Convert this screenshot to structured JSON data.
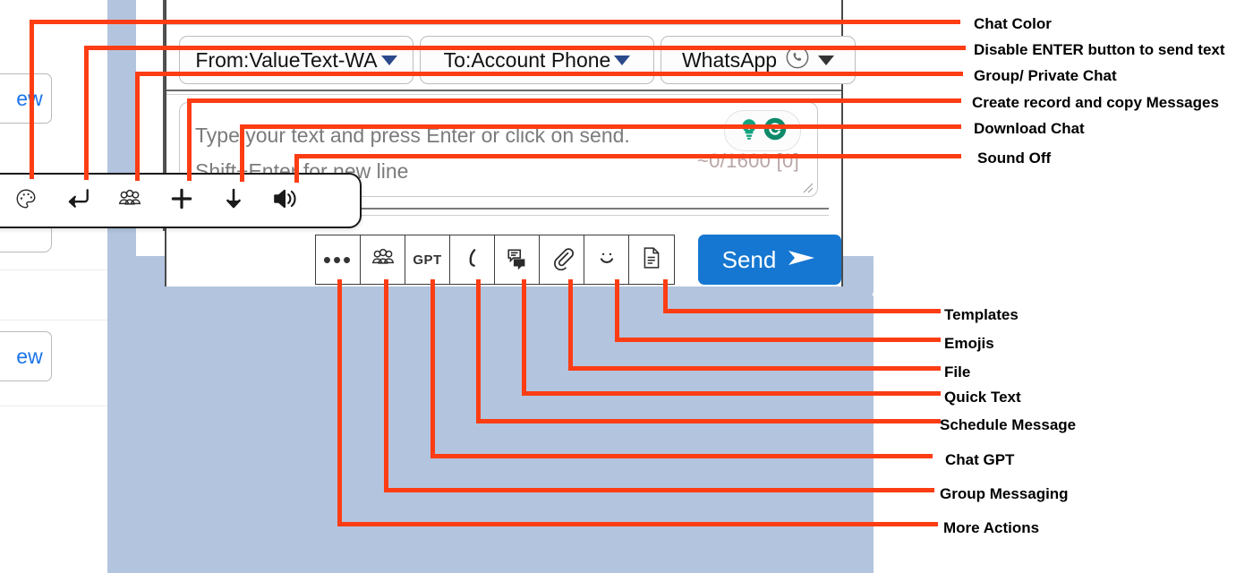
{
  "background": {
    "ghost_buttons": [
      {
        "label": "ew"
      },
      {
        "label": "ew"
      }
    ]
  },
  "compose_window": {
    "selects": [
      {
        "name": "from-select",
        "label": "From:ValueText-WA",
        "caret": "caret-down-icon"
      },
      {
        "name": "to-select",
        "label": "To:Account Phone",
        "caret": "caret-down-icon"
      },
      {
        "name": "channel-select",
        "label": "WhatsApp",
        "icon": "whatsapp-icon",
        "caret": "caret-down-icon"
      }
    ],
    "message_input": {
      "placeholder": "Type your text and press Enter or click on send. Shift+Enter for new line",
      "value": "",
      "counter": "~0/1600 [0]",
      "assistants": [
        "lightbulb-icon",
        "grammarly-icon"
      ]
    },
    "toolbar": [
      {
        "name": "more-actions-button",
        "icon": "ellipsis-icon",
        "glyph": "•••"
      },
      {
        "name": "group-messaging-button",
        "icon": "group-icon"
      },
      {
        "name": "chat-gpt-button",
        "icon": "gpt-icon",
        "glyph": "GPT"
      },
      {
        "name": "schedule-message-button",
        "icon": "clock-icon"
      },
      {
        "name": "quick-text-button",
        "icon": "quick-text-icon"
      },
      {
        "name": "file-button",
        "icon": "paperclip-icon"
      },
      {
        "name": "emojis-button",
        "icon": "smiley-icon"
      },
      {
        "name": "templates-button",
        "icon": "document-icon"
      }
    ],
    "send_button": {
      "label": "Send",
      "icon": "send-arrow-icon"
    }
  },
  "popup_toolbar": [
    {
      "name": "chat-color-button",
      "icon": "palette-icon"
    },
    {
      "name": "disable-enter-button",
      "icon": "enter-key-icon"
    },
    {
      "name": "group-private-chat-button",
      "icon": "group-icon"
    },
    {
      "name": "create-record-button",
      "icon": "plus-icon"
    },
    {
      "name": "download-chat-button",
      "icon": "download-arrow-icon"
    },
    {
      "name": "sound-off-button",
      "icon": "speaker-icon"
    }
  ],
  "annotations": {
    "top_right": [
      {
        "text": "Chat Color"
      },
      {
        "text": "Disable ENTER button to send text"
      },
      {
        "text": "Group/ Private Chat"
      },
      {
        "text": "Create record and copy Messages"
      },
      {
        "text": "Download Chat"
      },
      {
        "text": "Sound Off"
      }
    ],
    "bottom_right": [
      {
        "text": "Templates"
      },
      {
        "text": "Emojis"
      },
      {
        "text": "File"
      },
      {
        "text": "Quick Text"
      },
      {
        "text": "Schedule Message"
      },
      {
        "text": "Chat GPT"
      },
      {
        "text": "Group Messaging"
      },
      {
        "text": "More Actions"
      }
    ]
  },
  "colors": {
    "annotation": "#fc3d14",
    "send_blue": "#1577d1",
    "backdrop_blue": "#b3c4de",
    "link_blue": "#1a73e8",
    "teal": "#11a37f"
  }
}
